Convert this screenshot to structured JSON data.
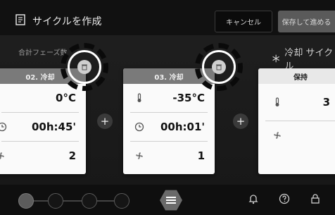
{
  "header": {
    "title": "サイクルを作成",
    "cancel_label": "キャンセル",
    "save_label": "保存して進める"
  },
  "summary": {
    "total_phases_label": "合計フェーズ数",
    "cycle_type_label": "冷却 サイクル",
    "cycle_icon": "snowflake-icon"
  },
  "cards": [
    {
      "title": "02. 冷却",
      "temperature": "0°C",
      "duration": "00h:45'",
      "fan": "2"
    },
    {
      "title": "03. 冷却",
      "temperature": "-35°C",
      "duration": "00h:01'",
      "fan": "1"
    },
    {
      "title": "保持",
      "temperature": "3",
      "fan": ""
    }
  ],
  "controls": {
    "add_symbol": "+",
    "menu_icon": "hamburger-icon"
  },
  "colors": {
    "card_header": "#7a7a7a",
    "card_bg": "#fafafa",
    "background": "#1a1a1a"
  }
}
